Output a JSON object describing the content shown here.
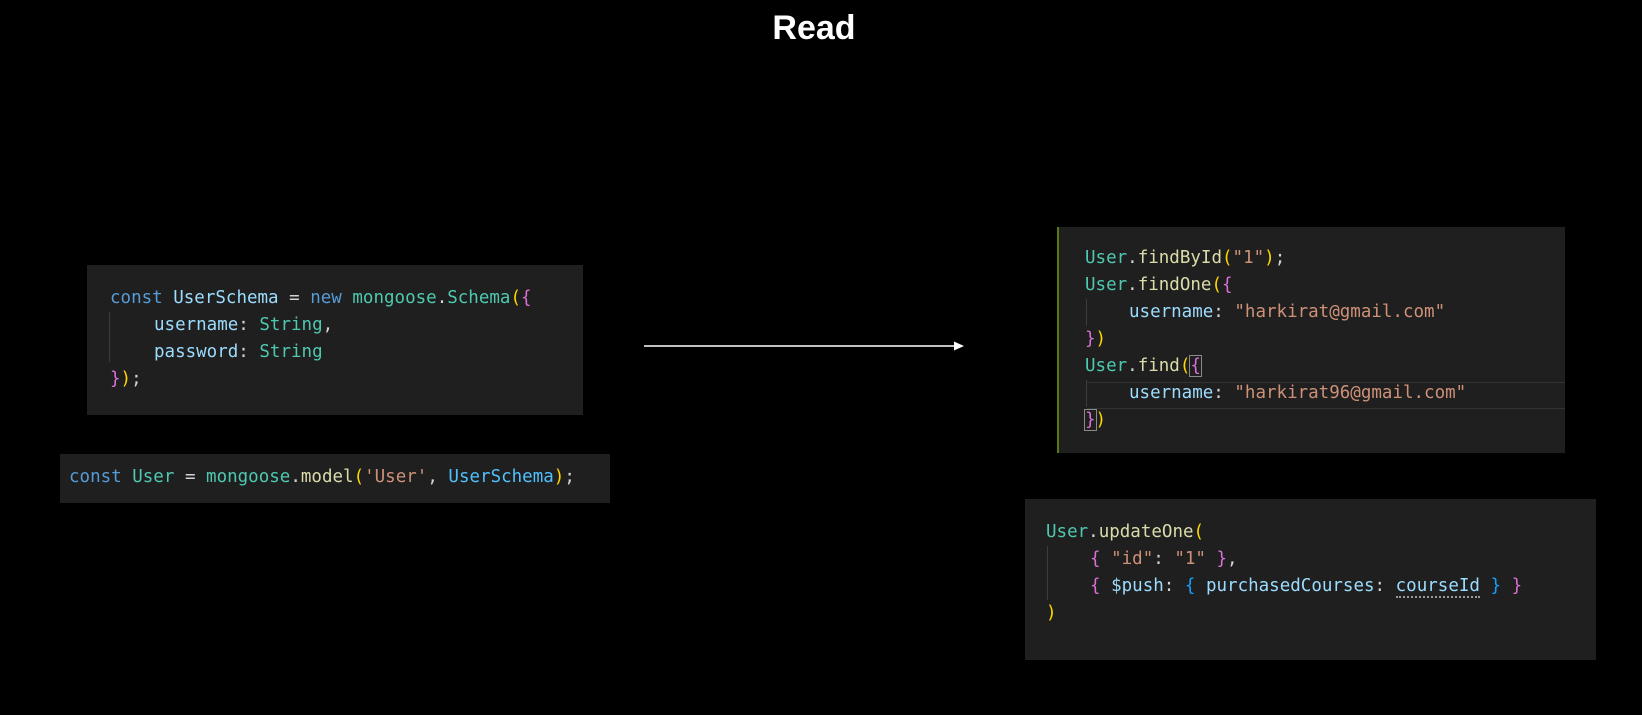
{
  "slide": {
    "title": "Read"
  },
  "schema_block": {
    "lines": [
      [
        "const",
        "UserSchema",
        "=",
        "new",
        "mongoose",
        ".",
        "Schema",
        "(",
        "{"
      ],
      [
        "username",
        ":",
        "String",
        ","
      ],
      [
        "password",
        ":",
        "String"
      ],
      [
        "}",
        ")",
        ";"
      ]
    ]
  },
  "model_block": {
    "tokens": [
      "const",
      "User",
      "=",
      "mongoose",
      ".",
      "model",
      "(",
      "'User'",
      ",",
      "UserSchema",
      ")",
      ";"
    ]
  },
  "read_block": {
    "l1": [
      "User",
      ".",
      "findById",
      "(",
      "\"1\"",
      ")",
      ";"
    ],
    "l2": [
      "User",
      ".",
      "findOne",
      "(",
      "{"
    ],
    "l3": [
      "username",
      ":",
      "\"harkirat@gmail.com\""
    ],
    "l4": [
      "}",
      ")"
    ],
    "l5": [
      "User",
      ".",
      "find",
      "(",
      "{"
    ],
    "l6": [
      "username",
      ":",
      "\"harkirat96@gmail.com\""
    ],
    "l7": [
      "}",
      ")"
    ]
  },
  "update_block": {
    "l1": [
      "User",
      ".",
      "updateOne",
      "("
    ],
    "l2": [
      "{",
      "\"id\"",
      ":",
      "\"1\"",
      "}",
      ","
    ],
    "l3": [
      "{",
      "$push",
      ":",
      "{",
      "purchasedCourses",
      ":",
      "courseId",
      "}",
      "}"
    ],
    "l4": [
      ")"
    ]
  },
  "colors": {
    "background": "#000000",
    "code_background": "#1f1f1f",
    "keyword": "#569cd6",
    "type": "#4ec9b0",
    "property": "#9cdcfe",
    "function": "#dcdcaa",
    "string": "#ce9178",
    "bracket_gold": "#ffd700",
    "bracket_magenta": "#da70d6",
    "bracket_blue": "#179fff",
    "git_added_bar": "#587c0c"
  },
  "icons": {
    "arrow": "right-arrow-icon"
  }
}
